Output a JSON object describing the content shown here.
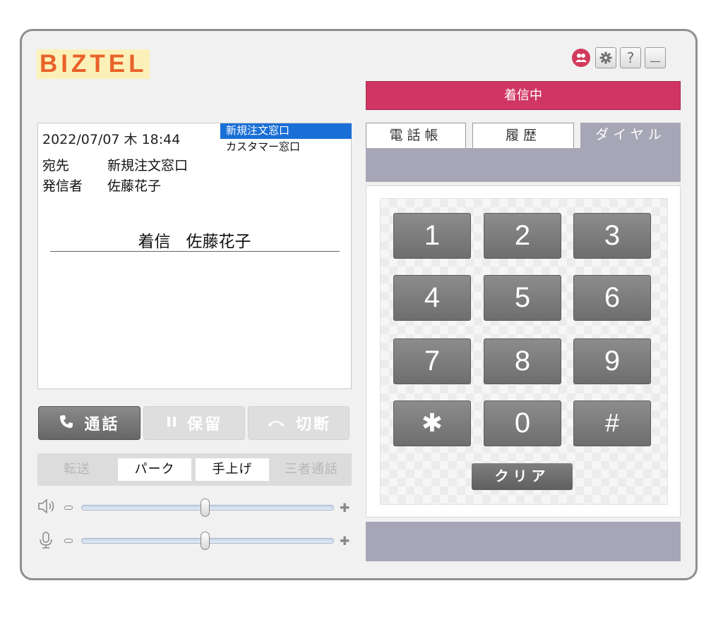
{
  "app": {
    "logo_text": "BIZTEL"
  },
  "header": {
    "icons": [
      "user-group-icon",
      "gear-icon",
      "help-icon",
      "minimize-icon"
    ],
    "help_label": "?",
    "minimize_label": "—"
  },
  "status": {
    "text": "着信中",
    "color": "#d03663"
  },
  "info": {
    "datetime": "2022/07/07 木 18:44",
    "queues": [
      "新規注文窓口",
      "カスタマー窓口"
    ],
    "selected_queue": "新規注文窓口",
    "destination_label": "宛先",
    "destination_value": "新規注文窓口",
    "caller_label": "発信者",
    "caller_value": "佐藤花子",
    "incoming_label": "着信",
    "incoming_name": "佐藤花子"
  },
  "call_buttons": {
    "answer": {
      "label": "通話",
      "icon": "phone-icon",
      "enabled": true
    },
    "hold": {
      "label": "保留",
      "icon": "pause-icon",
      "enabled": false
    },
    "hangup": {
      "label": "切断",
      "icon": "hangup-icon",
      "enabled": false
    }
  },
  "sub_buttons": [
    {
      "label": "転送",
      "enabled": false
    },
    {
      "label": "パーク",
      "enabled": true
    },
    {
      "label": "手上げ",
      "enabled": true
    },
    {
      "label": "三者通話",
      "enabled": false
    }
  ],
  "volume": {
    "speaker": {
      "icon": "speaker-icon",
      "level": 0.49
    },
    "microphone": {
      "icon": "microphone-icon",
      "level": 0.49
    }
  },
  "tabs": [
    {
      "label": "電話帳",
      "active": false
    },
    {
      "label": "履歴",
      "active": false
    },
    {
      "label": "ダイヤル",
      "active": true
    }
  ],
  "dialpad": {
    "keys": [
      "1",
      "2",
      "3",
      "4",
      "5",
      "6",
      "7",
      "8",
      "9",
      "✱",
      "0",
      "#"
    ],
    "clear_label": "クリア"
  }
}
